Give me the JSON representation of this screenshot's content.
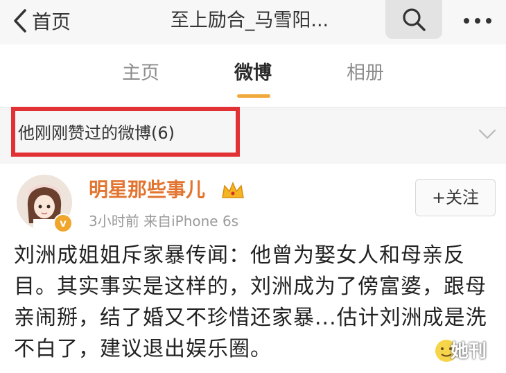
{
  "header": {
    "back_label": "首页",
    "title": "至上励合_马雪阳..."
  },
  "tabs": [
    {
      "label": "主页",
      "active": false
    },
    {
      "label": "微博",
      "active": true
    },
    {
      "label": "相册",
      "active": false
    }
  ],
  "liked_section": {
    "label": "他刚刚赞过的微博(6)"
  },
  "post": {
    "author": "明星那些事儿",
    "meta": "3小时前  来自iPhone 6s",
    "follow_label": "+关注",
    "verified_badge": "v",
    "text": "刘洲成姐姐斥家暴传闻：他曾为娶女人和母亲反目。其实事实是这样的，刘洲成为了傍富婆，跟母亲闹掰，结了婚又不珍惜还家暴...估计刘洲成是洗不白了，建议退出娱乐圈。"
  },
  "watermark": "她刊",
  "colors": {
    "accent_orange": "#f0a93a",
    "author_orange": "#e3742f",
    "highlight_red": "#e23134"
  },
  "icons": [
    "chevron-left-icon",
    "search-icon",
    "more-dots-icon",
    "chevron-down-icon",
    "crown-icon",
    "emoji-icon"
  ]
}
